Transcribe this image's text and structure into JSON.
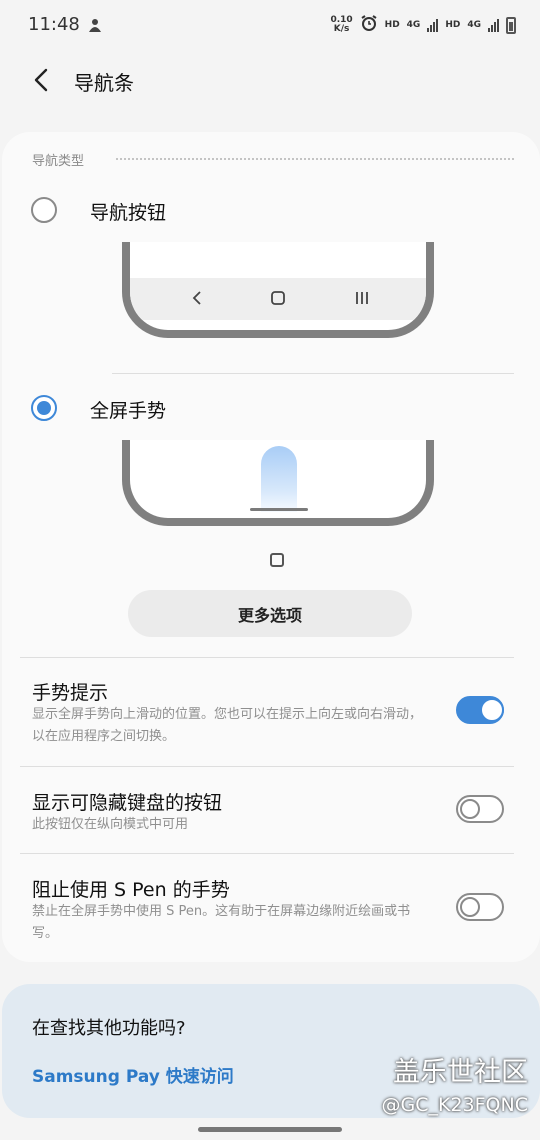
{
  "status_bar": {
    "time": "11:48",
    "speed_value": "0.10",
    "speed_unit": "K/s",
    "hd1": "HD",
    "net1": "4G",
    "hd2": "HD",
    "net2": "4G"
  },
  "header": {
    "title": "导航条"
  },
  "nav_type": {
    "section_label": "导航类型",
    "options": [
      {
        "label": "导航按钮",
        "selected": false
      },
      {
        "label": "全屏手势",
        "selected": true
      }
    ],
    "more_options_label": "更多选项"
  },
  "settings": [
    {
      "title": "手势提示",
      "subtitle": "显示全屏手势向上滑动的位置。您也可以在提示上向左或向右滑动，以在应用程序之间切换。",
      "enabled": true
    },
    {
      "title": "显示可隐藏键盘的按钮",
      "subtitle": "此按钮仅在纵向模式中可用",
      "enabled": false
    },
    {
      "title": "阻止使用 S Pen 的手势",
      "subtitle": "禁止在全屏手势中使用 S Pen。这有助于在屏幕边缘附近绘画或书写。",
      "enabled": false
    }
  ],
  "suggestion": {
    "title": "在查找其他功能吗?",
    "link": "Samsung Pay 快速访问"
  },
  "watermark": {
    "line1": "盖乐世社区",
    "line2": "@GC_K23FQNC"
  },
  "colors": {
    "accent": "#3e88d8",
    "link": "#2d7ac8"
  }
}
